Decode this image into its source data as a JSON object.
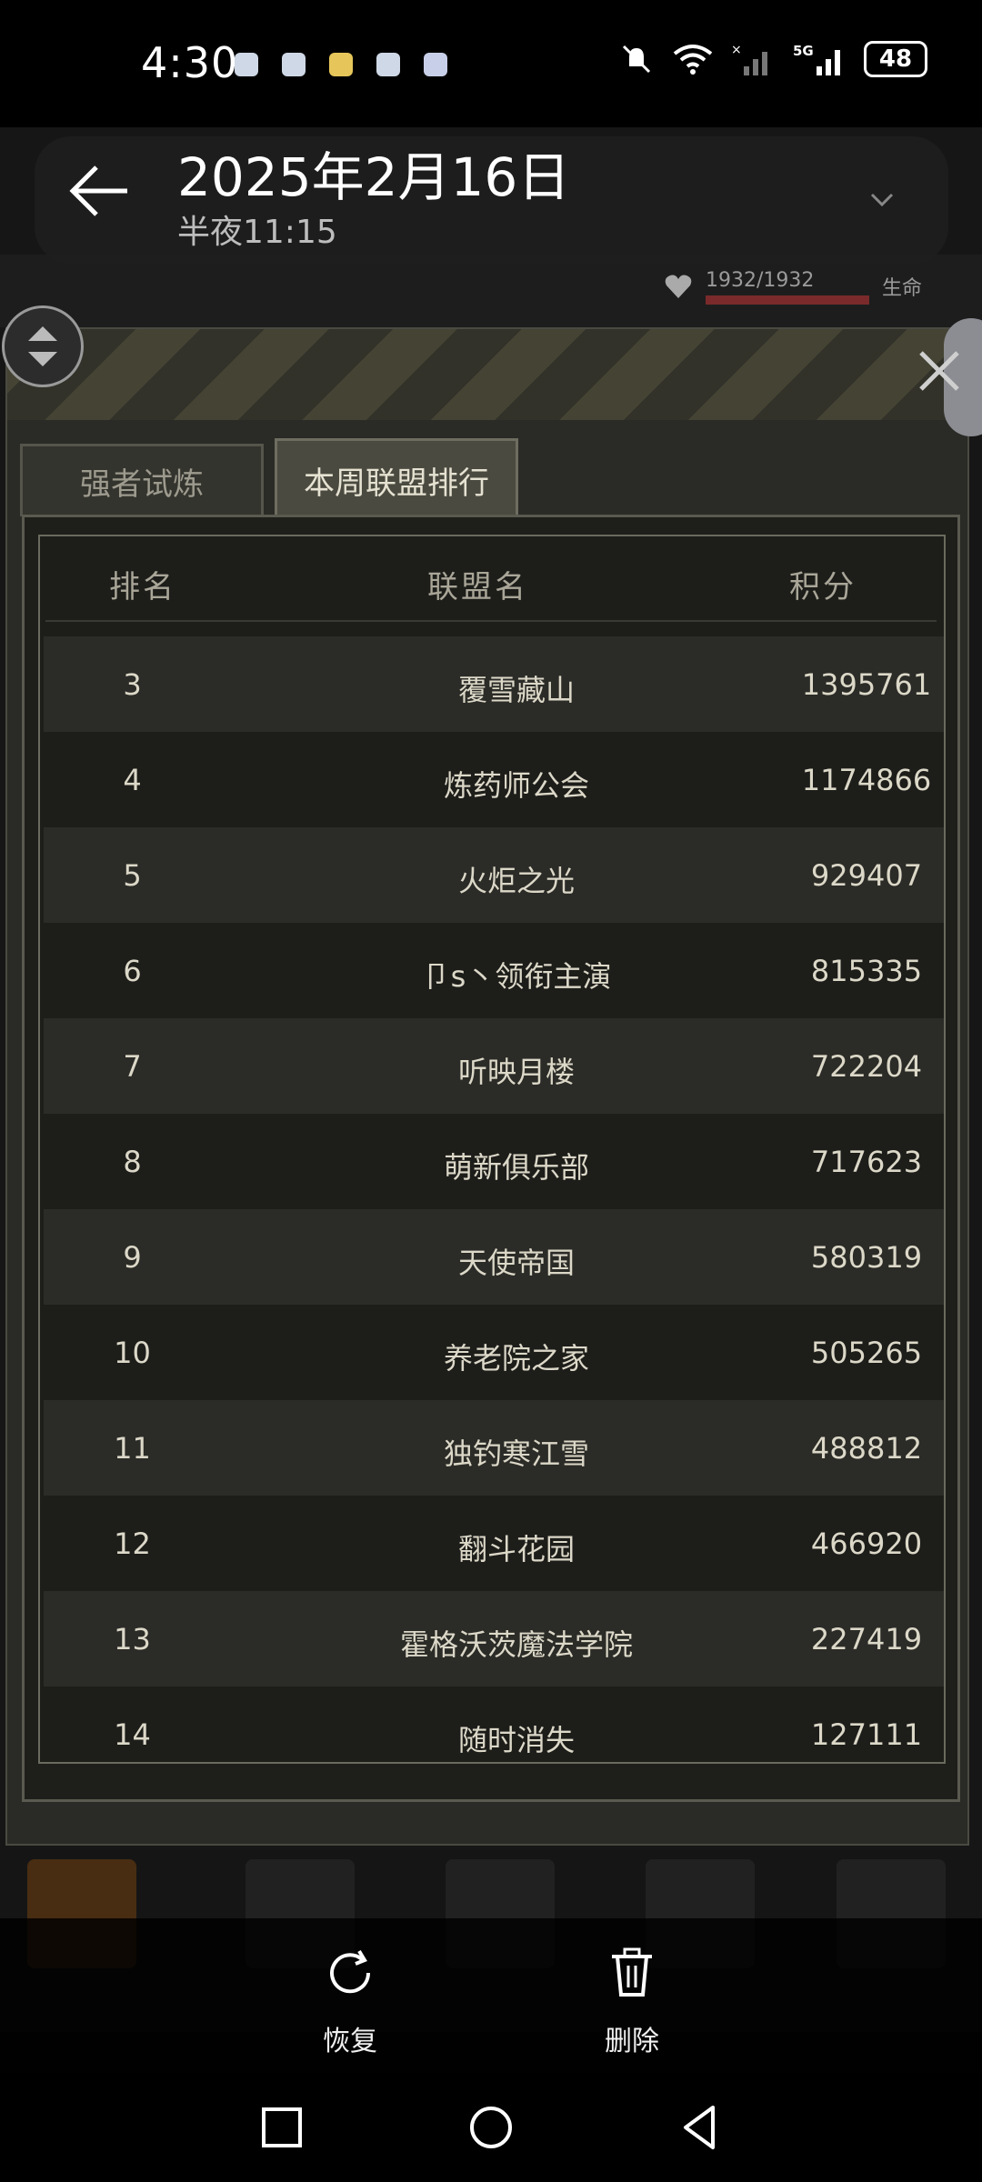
{
  "status_bar": {
    "time": "4:30",
    "battery": "48",
    "icons": [
      "mute-icon",
      "wifi-icon",
      "signal-no-sim-icon",
      "signal-5g-icon"
    ]
  },
  "viewer": {
    "date": "2025年2月16日",
    "time": "半夜11:15",
    "actions": [
      {
        "label": "恢复",
        "icon": "restore-icon"
      },
      {
        "label": "删除",
        "icon": "trash-icon"
      }
    ]
  },
  "game": {
    "hp": "1932/1932",
    "hp_label": "生命"
  },
  "tabs": [
    {
      "label": "强者试炼",
      "active": false
    },
    {
      "label": "本周联盟排行",
      "active": true
    }
  ],
  "table": {
    "headers": {
      "rank": "排名",
      "name": "联盟名",
      "score": "积分"
    },
    "rows": [
      {
        "rank": "3",
        "name": "覆雪藏山",
        "score": "1395761"
      },
      {
        "rank": "4",
        "name": "炼药师公会",
        "score": "1174866"
      },
      {
        "rank": "5",
        "name": "火炬之光",
        "score": "929407"
      },
      {
        "rank": "6",
        "name": "卩s丶领衔主演",
        "score": "815335"
      },
      {
        "rank": "7",
        "name": "听映月楼",
        "score": "722204"
      },
      {
        "rank": "8",
        "name": "萌新俱乐部",
        "score": "717623"
      },
      {
        "rank": "9",
        "name": "天使帝国",
        "score": "580319"
      },
      {
        "rank": "10",
        "name": "养老院之家",
        "score": "505265"
      },
      {
        "rank": "11",
        "name": "独钓寒江雪",
        "score": "488812"
      },
      {
        "rank": "12",
        "name": "翻斗花园",
        "score": "466920"
      },
      {
        "rank": "13",
        "name": "霍格沃茨魔法学院",
        "score": "227419"
      },
      {
        "rank": "14",
        "name": "随时消失",
        "score": "127111"
      }
    ]
  },
  "colors": {
    "panel": "#2a2a26",
    "row_alt": "#2b2b27",
    "row": "#1d1d1a",
    "text": "#dcd8c8",
    "header_text": "#a9a698"
  }
}
